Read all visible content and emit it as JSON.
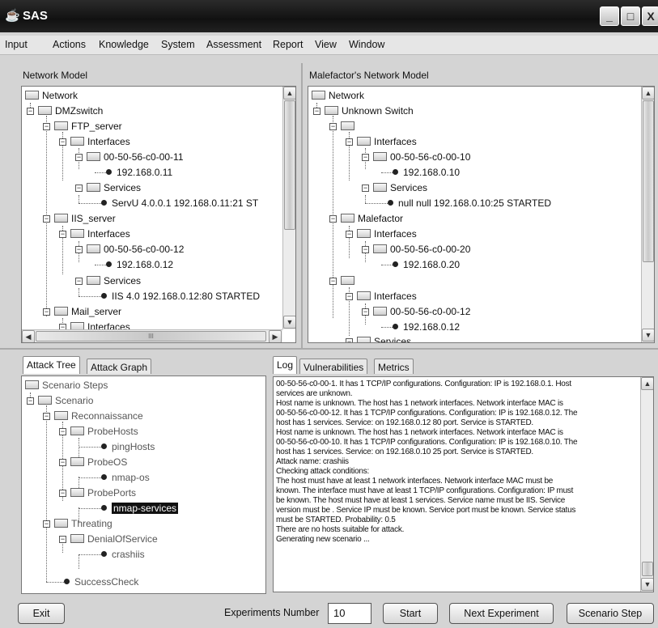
{
  "window": {
    "title": "SAS",
    "app_icon": "java-cup-icon",
    "minimize_glyph": "_",
    "maximize_glyph": "□",
    "close_glyph": "X"
  },
  "menu": [
    "Input",
    "Actions",
    "Knowledge",
    "System",
    "Assessment",
    "Report",
    "View",
    "Window"
  ],
  "network_model": {
    "title": "Network Model",
    "nodes": [
      "Network",
      "DMZswitch",
      "FTP_server",
      "Interfaces",
      "00-50-56-c0-00-11",
      "192.168.0.11",
      "Services",
      "ServU 4.0.0.1 192.168.0.11:21 ST",
      "IIS_server",
      "Interfaces",
      "00-50-56-c0-00-12",
      "192.168.0.12",
      "Services",
      "IIS 4.0 192.168.0.12:80 STARTED",
      "Mail_server",
      "Interfaces"
    ],
    "hscroll_grip": "III"
  },
  "malefactor_model": {
    "title": "Malefactor's Network Model",
    "nodes": [
      "Network",
      "Unknown Switch",
      "",
      "Interfaces",
      "00-50-56-c0-00-10",
      "192.168.0.10",
      "Services",
      "null null 192.168.0.10:25 STARTED",
      "Malefactor",
      "Interfaces",
      "00-50-56-c0-00-20",
      "192.168.0.20",
      "",
      "Interfaces",
      "00-50-56-c0-00-12",
      "192.168.0.12",
      "Services"
    ]
  },
  "left_tabs": [
    "Attack Tree",
    "Attack Graph"
  ],
  "attack_tree": {
    "nodes": [
      "Scenario Steps",
      "Scenario",
      "Reconnaissance",
      "ProbeHosts",
      "pingHosts",
      "ProbeOS",
      "nmap-os",
      "ProbePorts",
      "nmap-services",
      "Threating",
      "DenialOfService",
      "crashiis",
      "SuccessCheck"
    ],
    "selected": "nmap-services"
  },
  "right_tabs": [
    "Log",
    "Vulnerabilities",
    "Metrics"
  ],
  "log_lines": [
    "00-50-56-c0-00-1. It has 1 TCP/IP configurations. Configuration: IP is 192.168.0.1. Host",
    "services are unknown.",
    "Host name is unknown. The host has 1 network interfaces. Network interface MAC is",
    "00-50-56-c0-00-12. It has 1 TCP/IP configurations. Configuration: IP is 192.168.0.12. The",
    "host has 1 services. Service: on 192.168.0.12 80 port. Service is STARTED.",
    "Host name is unknown. The host has 1 network interfaces. Network interface MAC is",
    "00-50-56-c0-00-10. It has 1 TCP/IP configurations. Configuration: IP is 192.168.0.10. The",
    "host has 1 services. Service: on 192.168.0.10 25 port. Service is STARTED.",
    "Attack name: crashiis",
    "Checking attack conditions:",
    " The host must have at least 1 network interfaces. Network interface MAC must be",
    "known. The interface must have at least 1 TCP/IP configurations. Configuration: IP must",
    "be known. The host must have at least 1 services.  Service name must be IIS. Service",
    "version must be . Service IP must be known. Service port must be known. Service status",
    "must be STARTED. Probability: 0.5",
    "There are no hosts suitable for attack.",
    "Generating new scenario ..."
  ],
  "bottom": {
    "exit_label": "Exit",
    "experiments_label": "Experiments Number",
    "experiments_value": "10",
    "start_label": "Start",
    "next_label": "Next Experiment",
    "scenario_step_label": "Scenario Step"
  }
}
